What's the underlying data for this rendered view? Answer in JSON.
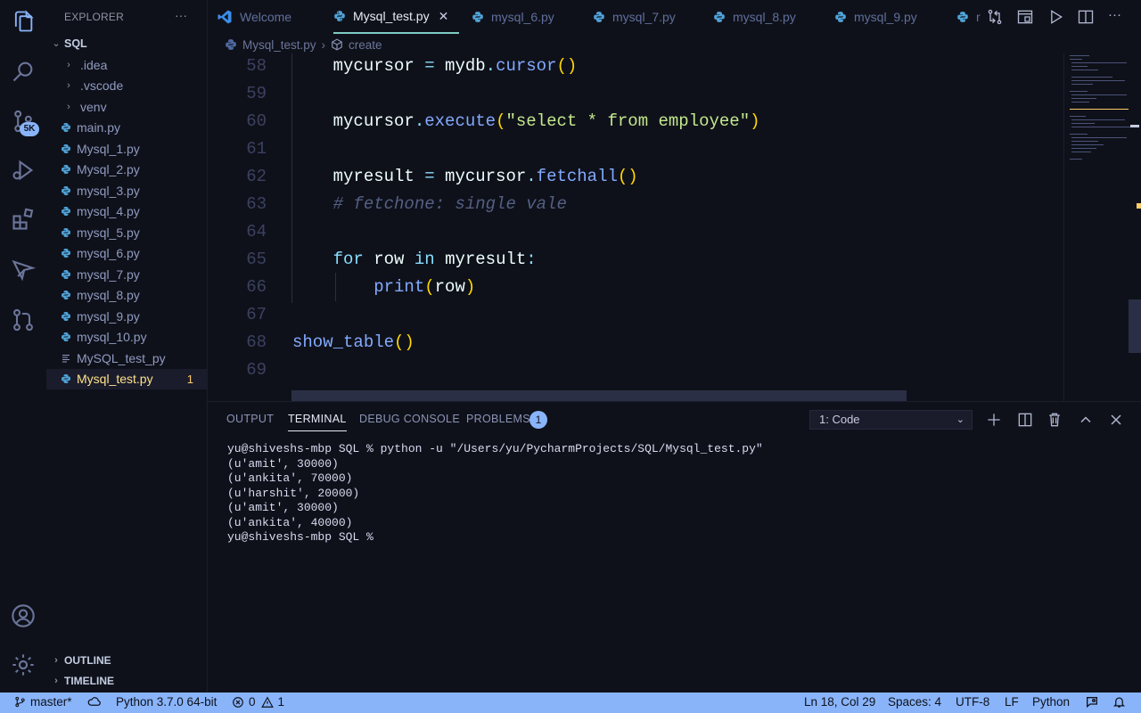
{
  "activity_bar": {
    "source_control_badge": "5K"
  },
  "sidebar": {
    "header": "EXPLORER",
    "more": "···",
    "folder": "SQL",
    "items": [
      {
        "label": ".idea",
        "kind": "folder"
      },
      {
        "label": ".vscode",
        "kind": "folder"
      },
      {
        "label": "venv",
        "kind": "folder"
      },
      {
        "label": "main.py",
        "kind": "python"
      },
      {
        "label": "Mysql_1.py",
        "kind": "python"
      },
      {
        "label": "Mysql_2.py",
        "kind": "python"
      },
      {
        "label": "mysql_3.py",
        "kind": "python"
      },
      {
        "label": "mysql_4.py",
        "kind": "python"
      },
      {
        "label": "mysql_5.py",
        "kind": "python"
      },
      {
        "label": "mysql_6.py",
        "kind": "python"
      },
      {
        "label": "mysql_7.py",
        "kind": "python"
      },
      {
        "label": "mysql_8.py",
        "kind": "python"
      },
      {
        "label": "mysql_9.py",
        "kind": "python"
      },
      {
        "label": "mysql_10.py",
        "kind": "python"
      },
      {
        "label": "MySQL_test_py",
        "kind": "text"
      },
      {
        "label": "Mysql_test.py",
        "kind": "python",
        "active": true,
        "problems": "1"
      }
    ],
    "outline": "OUTLINE",
    "timeline": "TIMELINE"
  },
  "tabs": [
    {
      "label": "Welcome",
      "icon": "vscode-icon"
    },
    {
      "label": "Mysql_test.py",
      "icon": "python-icon",
      "active": true,
      "close": "✕"
    },
    {
      "label": "mysql_6.py",
      "icon": "python-icon"
    },
    {
      "label": "mysql_7.py",
      "icon": "python-icon"
    },
    {
      "label": "mysql_8.py",
      "icon": "python-icon"
    },
    {
      "label": "mysql_9.py",
      "icon": "python-icon"
    },
    {
      "label": "r",
      "icon": "python-icon"
    }
  ],
  "breadcrumb": {
    "file": "Mysql_test.py",
    "symbol": "create"
  },
  "editor": {
    "line_numbers": [
      "58",
      "59",
      "60",
      "61",
      "62",
      "63",
      "64",
      "65",
      "66",
      "67",
      "68",
      "69"
    ]
  },
  "panel": {
    "tabs": {
      "output": "OUTPUT",
      "terminal": "TERMINAL",
      "debug": "DEBUG CONSOLE",
      "problems": "PROBLEMS"
    },
    "problems_count": "1",
    "terminal_select": "1: Code",
    "terminal_lines": [
      "yu@shiveshs-mbp SQL % python -u \"/Users/yu/PycharmProjects/SQL/Mysql_test.py\"",
      "(u'amit', 30000)",
      "(u'ankita', 70000)",
      "(u'harshit', 20000)",
      "(u'amit', 30000)",
      "(u'ankita', 40000)",
      "yu@shiveshs-mbp SQL %"
    ]
  },
  "status_bar": {
    "branch": "master*",
    "interpreter": "Python 3.7.0 64-bit",
    "errors": "0",
    "warnings": "1",
    "cursor": "Ln 18, Col 29",
    "spaces": "Spaces: 4",
    "encoding": "UTF-8",
    "eol": "LF",
    "language": "Python"
  },
  "colors": {
    "background": "#0f111a",
    "accent": "#89b4fa",
    "active_file": "#ffe28a",
    "keyword": "#89ddff",
    "function": "#82aaff",
    "string": "#c3e88d",
    "comment": "#545f83"
  }
}
